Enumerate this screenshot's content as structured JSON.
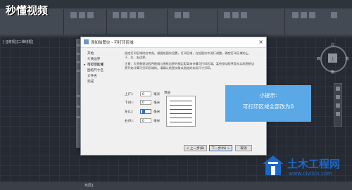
{
  "watermark": {
    "logo_text": "秒懂视频",
    "site_name": "土木工程网",
    "site_url": "www.civilcn.com"
  },
  "workspace": {
    "view_label": "[-][俯视][二维线框]",
    "layout_tab": "布局1"
  },
  "dialog": {
    "title": "添加绘图仪 - 可打印区域",
    "close_label": "×",
    "steps": [
      "开始",
      "介质边界",
      "可打印区域",
      "图纸尺寸名",
      "文件名",
      "完成"
    ],
    "active_step": 2,
    "description": [
      "指定打印区域时应考虑。根据绘图仪设置，打印区域，在绘图仪中进行调整，确定打印区域的上、下、左、右边界。",
      "注意：大多数驱动程序根据与图纸边界的指定距离来计算可打印区域。某些驱动程序是从实际图纸边界开始计算可打印区域的。请确认绘图仪能以指定的实际尺寸打印。"
    ],
    "fields": [
      {
        "label": "上(T):",
        "value": "0",
        "unit": "毫米"
      },
      {
        "label": "下(B):",
        "value": "0",
        "unit": "毫米"
      },
      {
        "label": "左(L):",
        "value": "",
        "unit": "毫米"
      },
      {
        "label": "右(R):",
        "value": "0",
        "unit": "毫米"
      }
    ],
    "preview_label": "预览",
    "buttons": {
      "back": "< 上一步(B)",
      "next": "下一步(N) >",
      "cancel": "取消"
    }
  },
  "hint": {
    "title": "小提示:",
    "body": "可打印区域全部改为0"
  },
  "viewcube": {
    "north": "北",
    "south": "南",
    "west": "西",
    "east": "东",
    "center": "上"
  }
}
